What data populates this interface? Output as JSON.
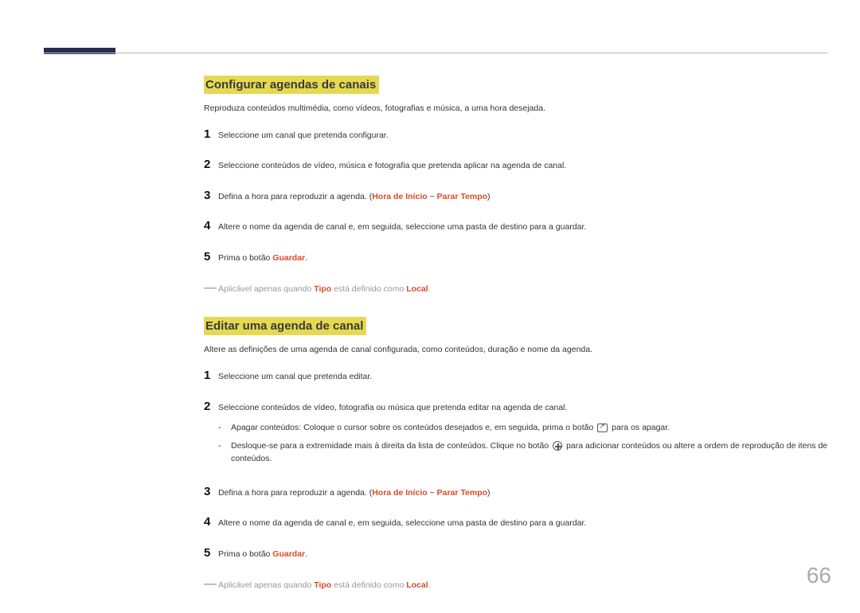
{
  "page_number": "66",
  "section1": {
    "heading": "Configurar agendas de canais",
    "intro": "Reproduza conteúdos multimédia, como vídeos, fotografias e música, a uma hora desejada.",
    "steps": {
      "n1": "1",
      "s1": "Seleccione um canal que pretenda configurar.",
      "n2": "2",
      "s2": "Seleccione conteúdos de vídeo, música e fotografia que pretenda aplicar na agenda de canal.",
      "n3": "3",
      "s3a": "Defina a hora para reproduzir a agenda. (",
      "s3b": "Hora de Início",
      "s3c": " ~ ",
      "s3d": "Parar Tempo",
      "s3e": ")",
      "n4": "4",
      "s4": "Altere o nome da agenda de canal e, em seguida, seleccione uma pasta de destino para a guardar.",
      "n5": "5",
      "s5a": "Prima o botão ",
      "s5b": "Guardar",
      "s5c": "."
    },
    "note": {
      "a": "Aplicável apenas quando ",
      "b": "Tipo",
      "c": " está definido como ",
      "d": "Local",
      "e": "."
    }
  },
  "section2": {
    "heading": "Editar uma agenda de canal",
    "intro": "Altere as definições de uma agenda de canal configurada, como conteúdos, duração e nome da agenda.",
    "steps": {
      "n1": "1",
      "s1": "Seleccione um canal que pretenda editar.",
      "n2": "2",
      "s2": "Seleccione conteúdos de vídeo, fotografia ou música que pretenda editar na agenda de canal.",
      "sub1a": "Apagar conteúdos: Coloque o cursor sobre os conteúdos desejados e, em seguida, prima o botão ",
      "sub1b": " para os apagar.",
      "sub2a": "Desloque-se para a extremidade mais à direita da lista de conteúdos. Clique no botão ",
      "sub2b": " para adicionar conteúdos ou altere a ordem de reprodução de itens de conteúdos.",
      "n3": "3",
      "s3a": "Defina a hora para reproduzir a agenda. (",
      "s3b": "Hora de Início",
      "s3c": " ~ ",
      "s3d": "Parar Tempo",
      "s3e": ")",
      "n4": "4",
      "s4": "Altere o nome da agenda de canal e, em seguida, seleccione uma pasta de destino para a guardar.",
      "n5": "5",
      "s5a": "Prima o botão ",
      "s5b": "Guardar",
      "s5c": "."
    },
    "note": {
      "a": "Aplicável apenas quando ",
      "b": "Tipo",
      "c": " está definido como ",
      "d": "Local",
      "e": "."
    }
  },
  "bullet": "-"
}
